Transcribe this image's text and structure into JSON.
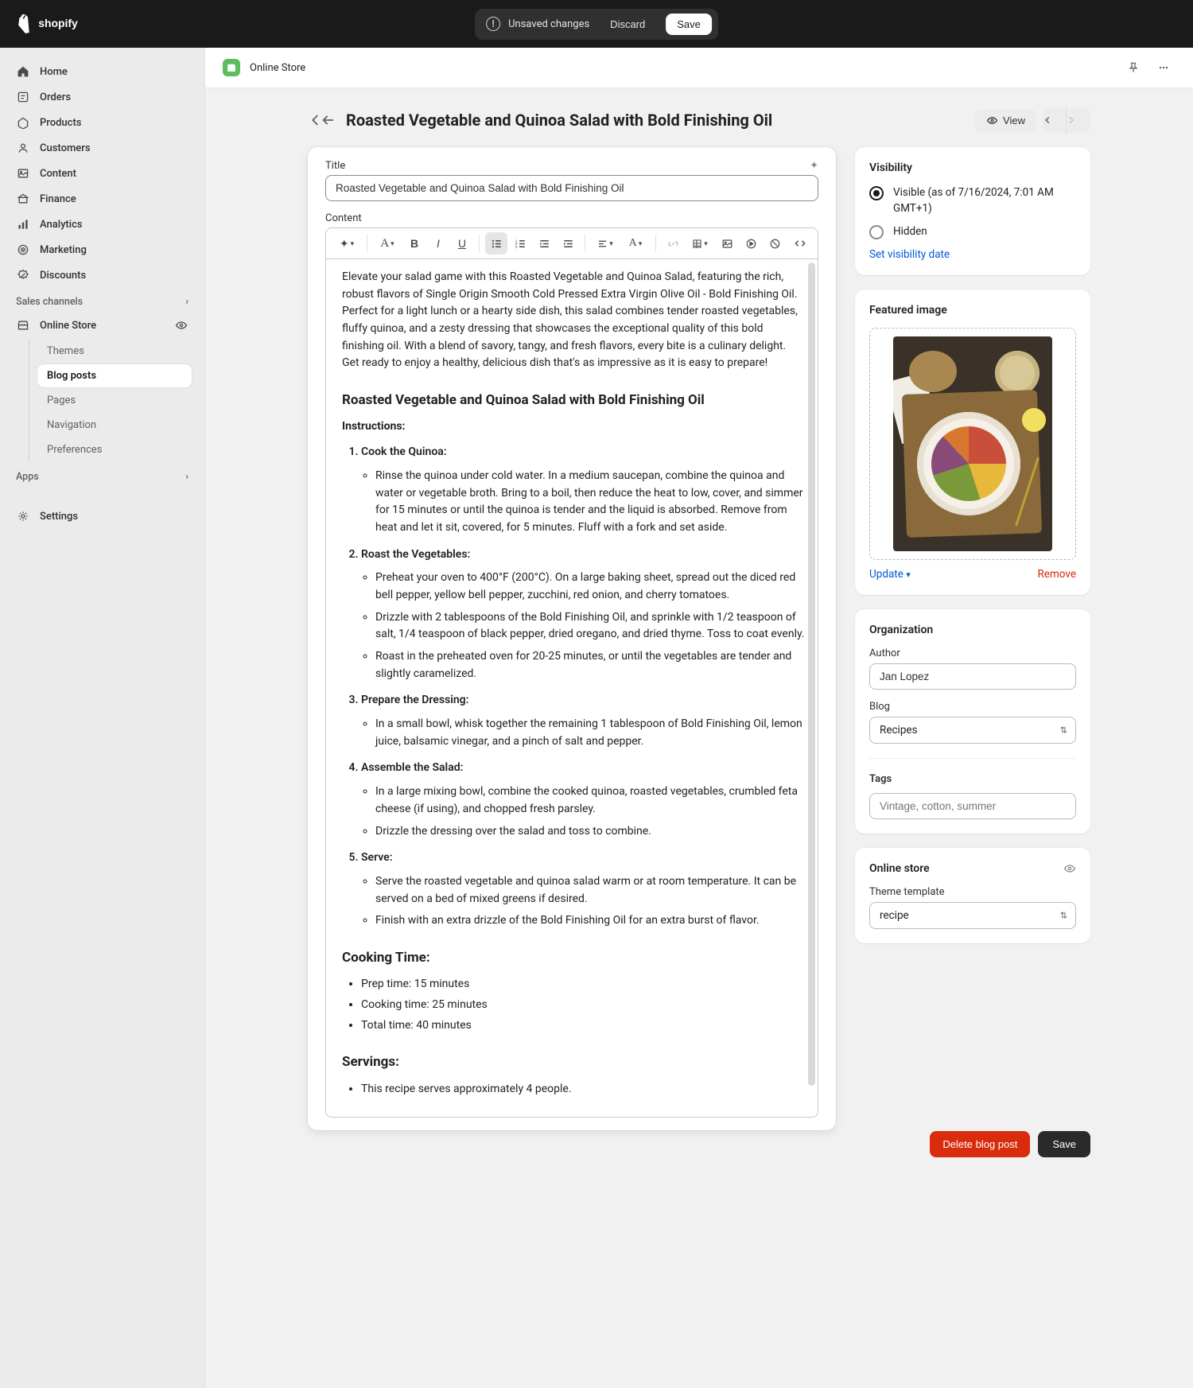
{
  "topbar": {
    "unsaved_msg": "Unsaved changes",
    "discard": "Discard",
    "save": "Save"
  },
  "sidebar": {
    "items": [
      {
        "label": "Home"
      },
      {
        "label": "Orders"
      },
      {
        "label": "Products"
      },
      {
        "label": "Customers"
      },
      {
        "label": "Content"
      },
      {
        "label": "Finance"
      },
      {
        "label": "Analytics"
      },
      {
        "label": "Marketing"
      },
      {
        "label": "Discounts"
      }
    ],
    "sales_channels_label": "Sales channels",
    "online_store": "Online Store",
    "subs": [
      {
        "label": "Themes"
      },
      {
        "label": "Blog posts"
      },
      {
        "label": "Pages"
      },
      {
        "label": "Navigation"
      },
      {
        "label": "Preferences"
      }
    ],
    "apps_label": "Apps",
    "settings": "Settings"
  },
  "header_bar": {
    "store_name": "Online Store"
  },
  "page": {
    "title": "Roasted Vegetable and Quinoa Salad with Bold Finishing Oil",
    "view": "View"
  },
  "editor": {
    "title_label": "Title",
    "title_value": "Roasted Vegetable and Quinoa Salad with Bold Finishing Oil",
    "content_label": "Content",
    "intro": "Elevate your salad game with this Roasted Vegetable and Quinoa Salad, featuring the rich, robust flavors of Single Origin Smooth Cold Pressed Extra Virgin Olive Oil - Bold Finishing Oil. Perfect for a light lunch or a hearty side dish, this salad combines tender roasted vegetables, fluffy quinoa, and a zesty dressing that showcases the exceptional quality of this bold finishing oil. With a blend of savory, tangy, and fresh flavors, every bite is a culinary delight. Get ready to enjoy a healthy, delicious dish that's as impressive as it is easy to prepare!",
    "h2": "Roasted Vegetable and Quinoa Salad with Bold Finishing Oil",
    "instructions_label": "Instructions:",
    "steps": [
      {
        "title": "Cook the Quinoa:",
        "subs": [
          "Rinse the quinoa under cold water. In a medium saucepan, combine the quinoa and water or vegetable broth. Bring to a boil, then reduce the heat to low, cover, and simmer for 15 minutes or until the quinoa is tender and the liquid is absorbed. Remove from heat and let it sit, covered, for 5 minutes. Fluff with a fork and set aside."
        ]
      },
      {
        "title": "Roast the Vegetables:",
        "subs": [
          "Preheat your oven to 400°F (200°C). On a large baking sheet, spread out the diced red bell pepper, yellow bell pepper, zucchini, red onion, and cherry tomatoes.",
          "Drizzle with 2 tablespoons of the Bold Finishing Oil, and sprinkle with 1/2 teaspoon of salt, 1/4 teaspoon of black pepper, dried oregano, and dried thyme. Toss to coat evenly.",
          "Roast in the preheated oven for 20-25 minutes, or until the vegetables are tender and slightly caramelized."
        ]
      },
      {
        "title": "Prepare the Dressing:",
        "subs": [
          "In a small bowl, whisk together the remaining 1 tablespoon of Bold Finishing Oil, lemon juice, balsamic vinegar, and a pinch of salt and pepper."
        ]
      },
      {
        "title": "Assemble the Salad:",
        "subs": [
          "In a large mixing bowl, combine the cooked quinoa, roasted vegetables, crumbled feta cheese (if using), and chopped fresh parsley.",
          "Drizzle the dressing over the salad and toss to combine."
        ]
      },
      {
        "title": "Serve:",
        "subs": [
          "Serve the roasted vegetable and quinoa salad warm or at room temperature. It can be served on a bed of mixed greens if desired.",
          "Finish with an extra drizzle of the Bold Finishing Oil for an extra burst of flavor."
        ]
      }
    ],
    "cooking_time_label": "Cooking Time:",
    "cooking_time": [
      "Prep time: 15 minutes",
      "Cooking time: 25 minutes",
      "Total time: 40 minutes"
    ],
    "servings_label": "Servings:",
    "servings": [
      "This recipe serves approximately 4 people."
    ]
  },
  "visibility": {
    "title": "Visibility",
    "visible_label": "Visible (as of 7/16/2024, 7:01 AM GMT+1)",
    "hidden_label": "Hidden",
    "set_date": "Set visibility date"
  },
  "featured": {
    "title": "Featured image",
    "update": "Update",
    "remove": "Remove"
  },
  "organization": {
    "title": "Organization",
    "author_label": "Author",
    "author_value": "Jan Lopez",
    "blog_label": "Blog",
    "blog_value": "Recipes",
    "tags_label": "Tags",
    "tags_placeholder": "Vintage, cotton, summer"
  },
  "online_store": {
    "title": "Online store",
    "template_label": "Theme template",
    "template_value": "recipe"
  },
  "footer": {
    "delete": "Delete blog post",
    "save": "Save"
  }
}
